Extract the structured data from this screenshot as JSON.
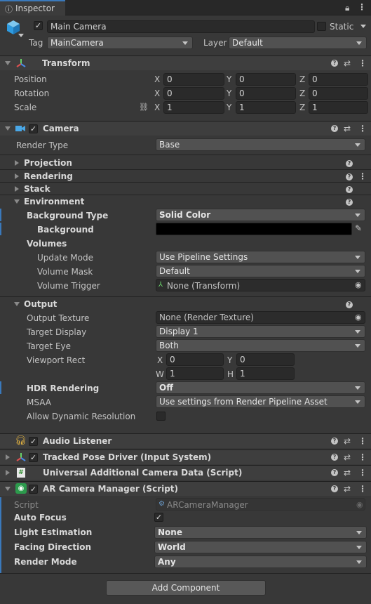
{
  "tab": {
    "title": "Inspector"
  },
  "header": {
    "name": "Main Camera",
    "static_label": "Static",
    "tag_label": "Tag",
    "tag_value": "MainCamera",
    "layer_label": "Layer",
    "layer_value": "Default"
  },
  "transform": {
    "title": "Transform",
    "position_label": "Position",
    "rotation_label": "Rotation",
    "scale_label": "Scale",
    "x": "X",
    "y": "Y",
    "z": "Z",
    "position": [
      "0",
      "0",
      "0"
    ],
    "rotation": [
      "0",
      "0",
      "0"
    ],
    "scale": [
      "1",
      "1",
      "1"
    ]
  },
  "camera": {
    "title": "Camera",
    "render_type_label": "Render Type",
    "render_type": "Base",
    "sections": {
      "projection": "Projection",
      "rendering": "Rendering",
      "stack": "Stack",
      "environment": "Environment",
      "output": "Output"
    },
    "environment": {
      "background_type_label": "Background Type",
      "background_type": "Solid Color",
      "background_label": "Background",
      "background_color": "#000000",
      "volumes_label": "Volumes",
      "update_mode_label": "Update Mode",
      "update_mode": "Use Pipeline Settings",
      "volume_mask_label": "Volume Mask",
      "volume_mask": "Default",
      "volume_trigger_label": "Volume Trigger",
      "volume_trigger": "None (Transform)"
    },
    "output": {
      "output_texture_label": "Output Texture",
      "output_texture": "None (Render Texture)",
      "target_display_label": "Target Display",
      "target_display": "Display 1",
      "target_eye_label": "Target Eye",
      "target_eye": "Both",
      "viewport_label": "Viewport Rect",
      "vx": "0",
      "vy": "0",
      "vw": "1",
      "vh": "1",
      "x": "X",
      "y": "Y",
      "w": "W",
      "h": "H",
      "hdr_label": "HDR Rendering",
      "hdr": "Off",
      "msaa_label": "MSAA",
      "msaa": "Use settings from Render Pipeline Asset",
      "dyn_label": "Allow Dynamic Resolution"
    }
  },
  "components": {
    "audio": "Audio Listener",
    "tpd": "Tracked Pose Driver (Input System)",
    "uacd": "Universal Additional Camera Data (Script)",
    "arcm": "AR Camera Manager (Script)"
  },
  "arcm": {
    "script_label": "Script",
    "script": "ARCameraManager",
    "auto_focus_label": "Auto Focus",
    "light_est_label": "Light Estimation",
    "light_est": "None",
    "facing_label": "Facing Direction",
    "facing": "World",
    "render_mode_label": "Render Mode",
    "render_mode": "Any"
  },
  "footer": {
    "add_component": "Add Component"
  },
  "colors": {
    "accent": "#3a79bb",
    "background": "#383838"
  }
}
